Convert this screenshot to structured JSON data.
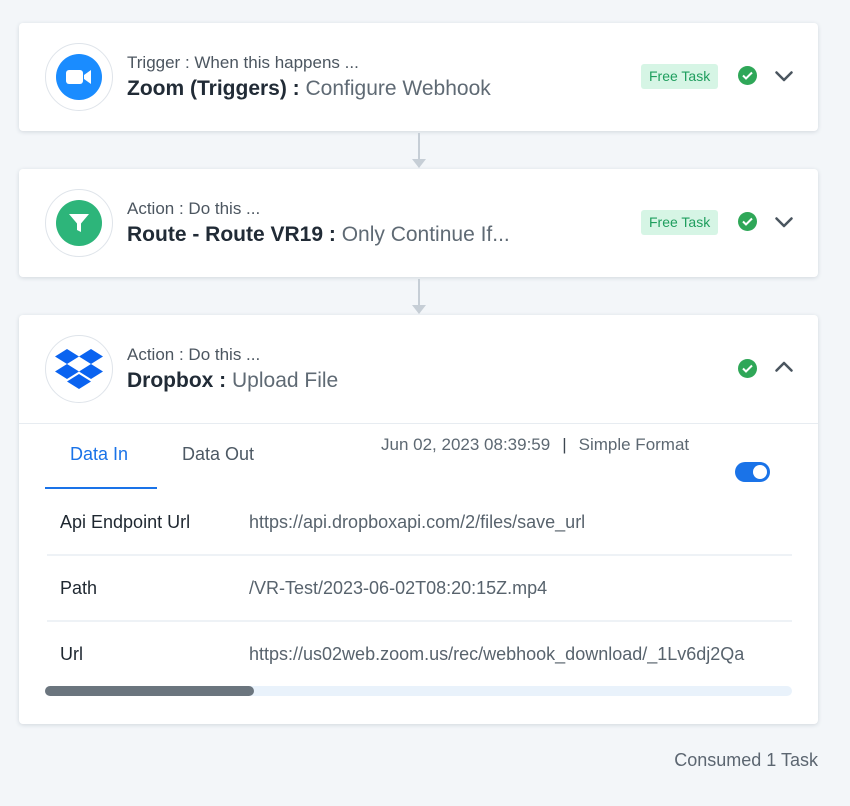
{
  "steps": [
    {
      "subtitle": "Trigger : When this happens ...",
      "app": "Zoom (Triggers) :",
      "action": "Configure Webhook",
      "badge": "Free Task",
      "icon": "video-camera-icon",
      "color": "#1a8cff",
      "expanded": false
    },
    {
      "subtitle": "Action : Do this ...",
      "app": "Route - Route VR19 :",
      "action": "Only Continue If...",
      "badge": "Free Task",
      "icon": "filter-icon",
      "color": "#2db57a",
      "expanded": false
    },
    {
      "subtitle": "Action : Do this ...",
      "app": "Dropbox :",
      "action": "Upload File",
      "icon": "dropbox-icon",
      "color": "#0a63f0",
      "expanded": true
    }
  ],
  "details": {
    "tabs": [
      "Data In",
      "Data Out"
    ],
    "active_tab": "Data In",
    "timestamp": "Jun 02, 2023 08:39:59",
    "separator": "|",
    "format_label": "Simple Format",
    "simple_format_enabled": true,
    "rows": [
      {
        "key": "Api Endpoint Url",
        "value": "https://api.dropboxapi.com/2/files/save_url"
      },
      {
        "key": "Path",
        "value": "/VR-Test/2023-06-02T08:20:15Z.mp4"
      },
      {
        "key": "Url",
        "value": "https://us02web.zoom.us/rec/webhook_download/_1Lv6dj2Qa"
      }
    ],
    "scroll_fraction": 0.28
  },
  "footer": {
    "consumed": "Consumed 1 Task"
  },
  "colors": {
    "accent": "#1a73e8",
    "success": "#2fa758",
    "free_badge_bg": "#d6f5e5",
    "free_badge_text": "#1f9e5e",
    "background": "#f3f6f9"
  }
}
